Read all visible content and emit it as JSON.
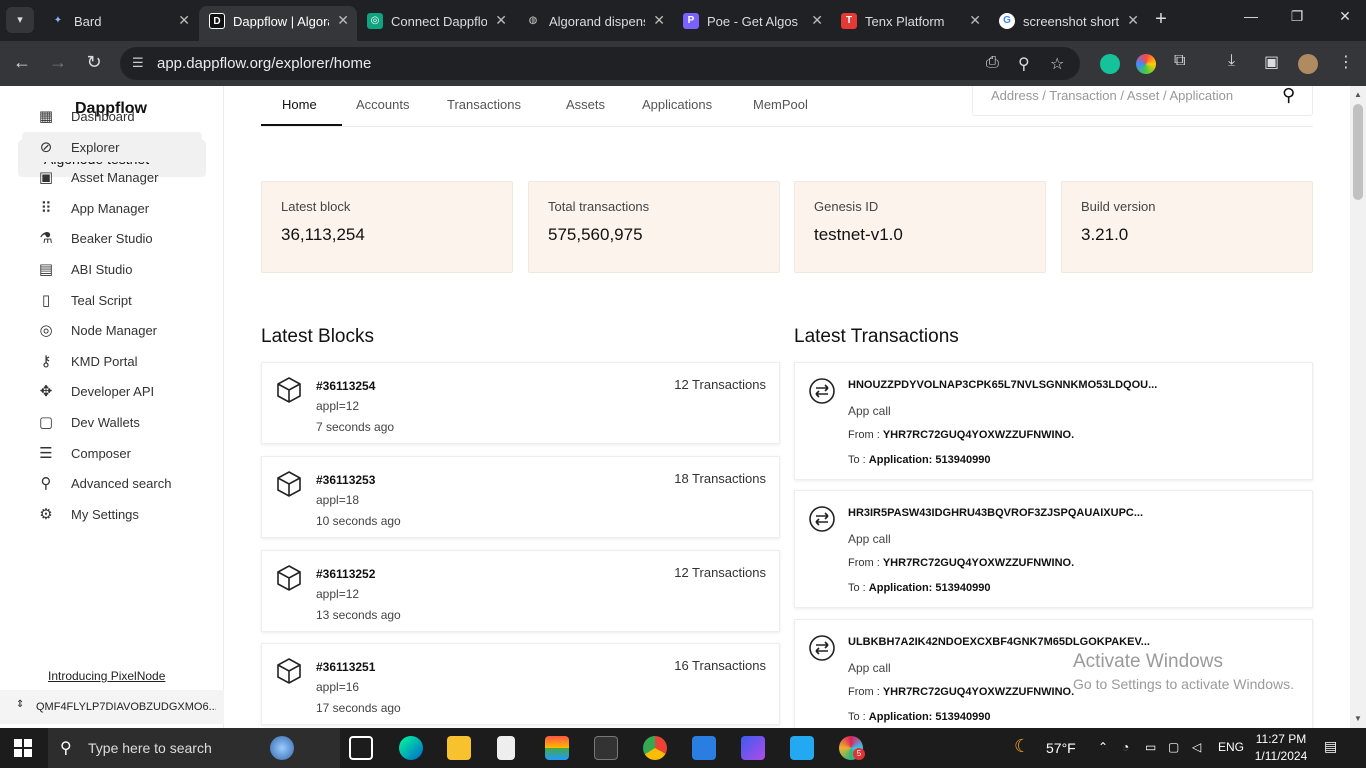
{
  "browser": {
    "tabs": [
      {
        "title": "Bard",
        "icon": "bard-icon",
        "color": "#8ab4f8"
      },
      {
        "title": "Dappflow | Algorand Explorer",
        "icon": "dappflow-icon",
        "color": "#ffffff"
      },
      {
        "title": "Connect Dappflow",
        "icon": "chatgpt-icon",
        "color": "#10a37f"
      },
      {
        "title": "Algorand dispenser",
        "icon": "globe-icon",
        "color": "#9aa0a6"
      },
      {
        "title": "Poe - Get Algos",
        "icon": "poe-icon",
        "color": "#7b61ff"
      },
      {
        "title": "Tenx Platform",
        "icon": "tenx-icon",
        "color": "#e53935"
      },
      {
        "title": "screenshot shortcut",
        "icon": "google-icon",
        "color": "#4285f4"
      }
    ],
    "url": "app.dappflow.org/explorer/home"
  },
  "sidebar": {
    "logo": "Dappflow",
    "network": "Algonode testnet",
    "items": [
      {
        "label": "Dashboard",
        "icon": "dashboard-icon",
        "glyph": "▦"
      },
      {
        "label": "Explorer",
        "icon": "compass-icon",
        "glyph": "⊘"
      },
      {
        "label": "Asset Manager",
        "icon": "asset-icon",
        "glyph": "▣"
      },
      {
        "label": "App Manager",
        "icon": "apps-grid-icon",
        "glyph": "⠿"
      },
      {
        "label": "Beaker Studio",
        "icon": "beaker-icon",
        "glyph": "⚗"
      },
      {
        "label": "ABI Studio",
        "icon": "abi-icon",
        "glyph": "▤"
      },
      {
        "label": "Teal Script",
        "icon": "document-icon",
        "glyph": "▯"
      },
      {
        "label": "Node Manager",
        "icon": "node-icon",
        "glyph": "◎"
      },
      {
        "label": "KMD Portal",
        "icon": "key-icon",
        "glyph": "⚷"
      },
      {
        "label": "Developer API",
        "icon": "api-icon",
        "glyph": "✥"
      },
      {
        "label": "Dev Wallets",
        "icon": "wallet-icon",
        "glyph": "▢"
      },
      {
        "label": "Composer",
        "icon": "composer-icon",
        "glyph": "☰"
      },
      {
        "label": "Advanced search",
        "icon": "search-icon",
        "glyph": "⚲"
      },
      {
        "label": "My Settings",
        "icon": "gear-icon",
        "glyph": "⚙"
      }
    ],
    "intro_link": "Introducing PixelNode",
    "account": "QMF4FLYLP7DIAVOBZUDGXMO6..."
  },
  "nav": {
    "tabs": [
      "Home",
      "Accounts",
      "Transactions",
      "Assets",
      "Applications",
      "MemPool"
    ],
    "search_placeholder": "Address / Transaction / Asset / Application"
  },
  "stats": [
    {
      "label": "Latest block",
      "value": "36,113,254"
    },
    {
      "label": "Total transactions",
      "value": "575,560,975"
    },
    {
      "label": "Genesis ID",
      "value": "testnet-v1.0"
    },
    {
      "label": "Build version",
      "value": "3.21.0"
    }
  ],
  "latest_blocks": {
    "title": "Latest Blocks",
    "items": [
      {
        "number": "#36113254",
        "appl": "appl=12",
        "time": "7 seconds ago",
        "count": "12 Transactions"
      },
      {
        "number": "#36113253",
        "appl": "appl=18",
        "time": "10 seconds ago",
        "count": "18 Transactions"
      },
      {
        "number": "#36113252",
        "appl": "appl=12",
        "time": "13 seconds ago",
        "count": "12 Transactions"
      },
      {
        "number": "#36113251",
        "appl": "appl=16",
        "time": "17 seconds ago",
        "count": "16 Transactions"
      }
    ]
  },
  "latest_transactions": {
    "title": "Latest Transactions",
    "from_label": "From :",
    "to_label": "To :",
    "items": [
      {
        "id": "HNOUZZPDYVOLNAP3CPK65L7NVLSGNNKMO53LDQOU...",
        "type": "App call",
        "from": "YHR7RC72GUQ4YOXWZZUFNWINO...",
        "to": "Application: 513940990"
      },
      {
        "id": "HR3IR5PASW43IDGHRU43BQVROF3ZJSPQAUAIXUPC...",
        "type": "App call",
        "from": "YHR7RC72GUQ4YOXWZZUFNWINO...",
        "to": "Application: 513940990"
      },
      {
        "id": "ULBKBH7A2IK42NDOEXCXBF4GNK7M65DLGOKPAKEV...",
        "type": "App call",
        "from": "YHR7RC72GUQ4YOXWZZUFNWINO...",
        "to": "Application: 513940990"
      }
    ]
  },
  "watermark": {
    "line1": "Activate Windows",
    "line2": "Go to Settings to activate Windows."
  },
  "taskbar": {
    "search_placeholder": "Type here to search",
    "weather": "57°F",
    "language": "ENG",
    "time": "11:27 PM",
    "date": "1/11/2024",
    "badge": "5"
  }
}
